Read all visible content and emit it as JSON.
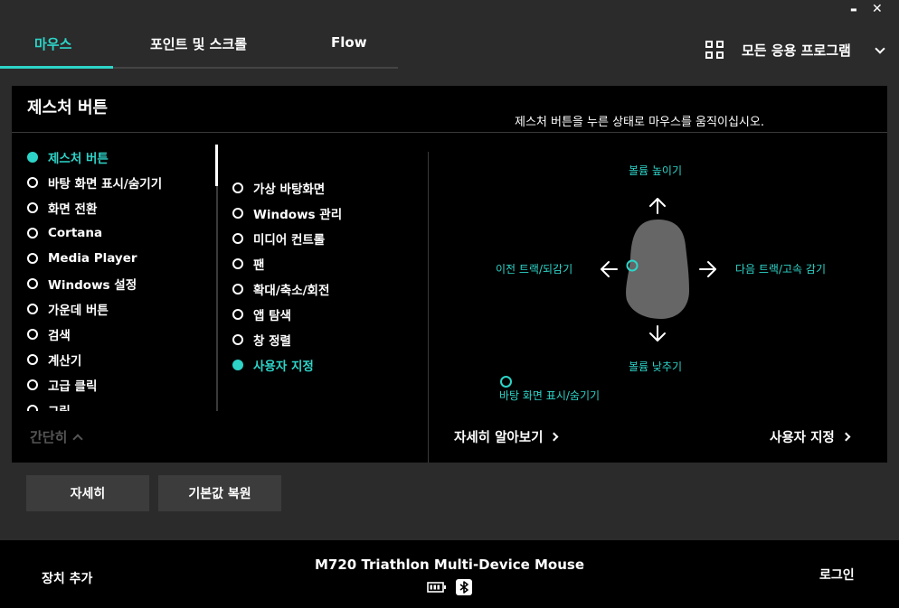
{
  "window": {
    "minimize_glyph": "▬",
    "close_glyph": "✕"
  },
  "tabs": [
    {
      "label": "마우스",
      "active": true
    },
    {
      "label": "포인트 및 스크롤",
      "active": false
    },
    {
      "label": "Flow",
      "active": false
    }
  ],
  "app_selector": {
    "icon": "grid-icon",
    "label": "모든 응용 프로그램"
  },
  "panel": {
    "title": "제스처 버튼",
    "hint": "제스처 버튼을 누른 상태로 마우스를 움직이십시오.",
    "left_list": [
      {
        "label": "제스처 버튼",
        "selected": true
      },
      {
        "label": "바탕 화면 표시/숨기기",
        "selected": false
      },
      {
        "label": "화면 전환",
        "selected": false
      },
      {
        "label": "Cortana",
        "selected": false
      },
      {
        "label": "Media Player",
        "selected": false
      },
      {
        "label": "Windows 설정",
        "selected": false
      },
      {
        "label": "가운데 버튼",
        "selected": false
      },
      {
        "label": "검색",
        "selected": false
      },
      {
        "label": "계산기",
        "selected": false
      },
      {
        "label": "고급 클릭",
        "selected": false
      },
      {
        "label": "그림",
        "selected": false
      }
    ],
    "mid_list": [
      {
        "label": "가상 바탕화면",
        "selected": false
      },
      {
        "label": "Windows 관리",
        "selected": false
      },
      {
        "label": "미디어 컨트롤",
        "selected": false
      },
      {
        "label": "팬",
        "selected": false
      },
      {
        "label": "확대/축소/회전",
        "selected": false
      },
      {
        "label": "앱 탐색",
        "selected": false
      },
      {
        "label": "창 정렬",
        "selected": false
      },
      {
        "label": "사용자 지정",
        "selected": true
      }
    ],
    "simple_toggle": "간단히",
    "gestures": {
      "up": "볼륨 높이기",
      "down": "볼륨 낮추기",
      "left": "이전 트랙/되감기",
      "right": "다음 트랙/고속 감기",
      "click": "바탕 화면 표시/숨기기"
    },
    "learn_more": "자세히 알아보기",
    "customize": "사용자 지정"
  },
  "buttons": {
    "details": "자세히",
    "restore": "기본값 복원"
  },
  "footer": {
    "add_device": "장치 추가",
    "device_name": "M720 Triathlon Multi-Device Mouse",
    "battery_icon": "battery-icon",
    "connection_icon": "bluetooth-icon",
    "login": "로그인"
  },
  "colors": {
    "accent": "#2dd4c8",
    "background": "#2b2b2b",
    "panel": "#000000",
    "button": "#3c3c3c",
    "mouse_body": "#666666"
  }
}
